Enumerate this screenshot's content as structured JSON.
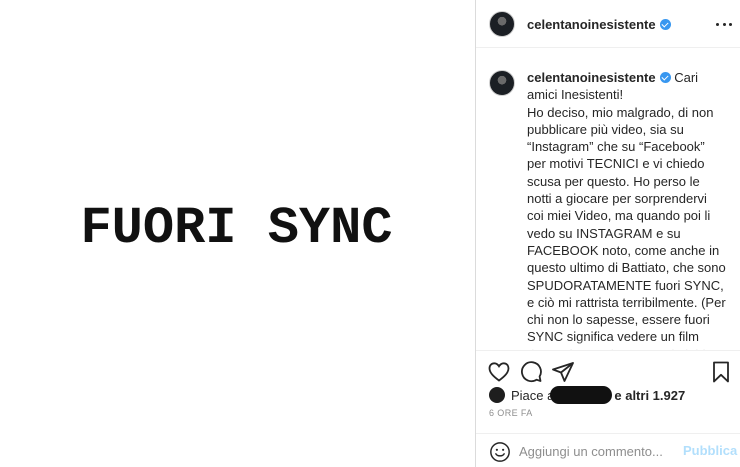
{
  "post": {
    "image_text": "FUORI SYNC"
  },
  "header": {
    "username": "celentanoinesistente",
    "verified_icon": "verified-badge-icon",
    "more_icon": "more-options-icon"
  },
  "caption": {
    "username": "celentanoinesistente",
    "first_line": "Cari amici Inesistenti!",
    "text": "Ho deciso, mio malgrado, di non pubblicare più video, sia su “Instagram” che su “Facebook” per motivi TECNICI e vi chiedo scusa per questo. Ho perso le notti a giocare per sorprendervi coi miei Video, ma quando poi li vedo su INSTAGRAM e su FACEBOOK noto, come anche in questo ultimo di Battiato, che sono SPUDORATAMENTE fuori SYNC, e ciò mi rattrista terribilmente. (Per chi non lo sapesse, essere fuori SYNC significa vedere un film dove c’è uno che muove le labbra, ma non si capisce cosa dice perché l’AUDIO non va insieme al movimento della bocca). Un difetto d’orig di"
  },
  "actions": {
    "like_icon": "heart-icon",
    "comment_icon": "comment-icon",
    "share_icon": "share-icon",
    "save_icon": "bookmark-icon"
  },
  "likes": {
    "prefix": "Piace a",
    "suffix": "e altri 1.927"
  },
  "timestamp": "6 ORE FA",
  "comment_bar": {
    "emoji_icon": "emoji-icon",
    "placeholder": "Aggiungi un commento...",
    "publish_label": "Pubblica",
    "publish_color": "#b2dffc"
  },
  "colors": {
    "text": "#262626",
    "secondary": "#8e8e8e",
    "verified": "#3897f0",
    "border": "#dbdbdb"
  }
}
